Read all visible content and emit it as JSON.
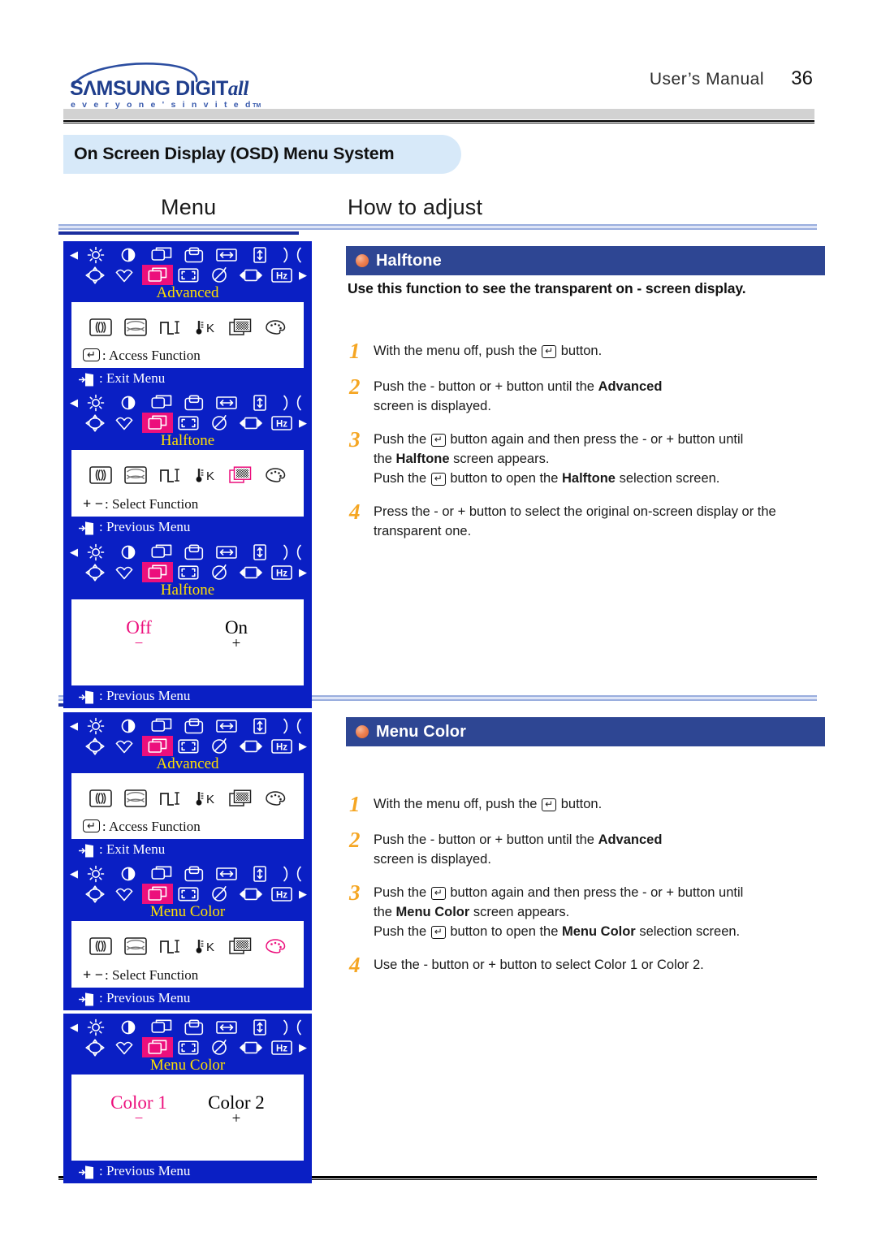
{
  "header": {
    "brand_primary": "SΛMSUNG DIGIT",
    "brand_italic": "all",
    "brand_tagline": "e v e r y o n e ' s   i n v i t e d",
    "brand_tm": "TM",
    "manual_label": "User’s Manual",
    "page_number": "36"
  },
  "title_band": {
    "text": "On Screen Display (OSD) Menu System"
  },
  "columns": {
    "menu": "Menu",
    "how_to_adjust": "How to adjust"
  },
  "icons": {
    "row1": [
      "brightness-icon",
      "contrast-icon",
      "h-position-icon",
      "v-position-icon",
      "h-size-icon",
      "v-size-icon",
      "pincushion-icon"
    ],
    "row2": [
      "rotation-icon",
      "trapezoid-icon",
      "advanced-icon",
      "zoom-icon",
      "degauss-icon",
      "moire-icon",
      "frequency-hz-icon"
    ],
    "submenu": [
      "purity-icon",
      "linearity-icon",
      "video-level-icon",
      "color-temp-k-icon",
      "halftone-icon",
      "menu-color-palette-icon"
    ],
    "hz_label": "Hz",
    "kelvin_label": "K",
    "left_arrow": "◀",
    "right_arrow": "▶"
  },
  "osd_panels": [
    {
      "id": "advanced-1",
      "title": "Advanced",
      "selected_top_index": 2,
      "selected_sub_index": -1,
      "hint": ": Access Function",
      "hint_glyph": "enter-key",
      "footer": ": Exit Menu",
      "footer_glyph": "exit-door"
    },
    {
      "id": "halftone-selected",
      "title": "Halftone",
      "selected_top_index": 2,
      "selected_sub_index": 4,
      "hint": ": Select Function",
      "hint_glyph": "plus-minus",
      "hint_prefix": "+ −",
      "footer": ": Previous Menu",
      "footer_glyph": "exit-door"
    },
    {
      "id": "halftone-options",
      "title": "Halftone",
      "selected_top_index": 2,
      "options": [
        {
          "label": "Off",
          "sign": "−",
          "state": "selected"
        },
        {
          "label": "On",
          "sign": "+",
          "state": "normal"
        }
      ],
      "footer": ": Previous Menu",
      "footer_glyph": "exit-door"
    },
    {
      "id": "advanced-2",
      "title": "Advanced",
      "selected_top_index": 2,
      "selected_sub_index": -1,
      "hint": ": Access Function",
      "hint_glyph": "enter-key",
      "footer": ": Exit Menu",
      "footer_glyph": "exit-door"
    },
    {
      "id": "menucolor-selected",
      "title": "Menu Color",
      "selected_top_index": 2,
      "selected_sub_index": 5,
      "hint": ": Select Function",
      "hint_glyph": "plus-minus",
      "hint_prefix": "+ −",
      "footer": ": Previous Menu",
      "footer_glyph": "exit-door"
    },
    {
      "id": "menucolor-options",
      "title": "Menu Color",
      "selected_top_index": 2,
      "options": [
        {
          "label": "Color 1",
          "sign": "−",
          "state": "selected"
        },
        {
          "label": "Color 2",
          "sign": "+",
          "state": "normal"
        }
      ],
      "footer": ": Previous Menu",
      "footer_glyph": "exit-door"
    }
  ],
  "sections": [
    {
      "id": "halftone",
      "title": "Halftone",
      "lead": "Use this function to see the transparent on - screen display.",
      "steps": [
        {
          "num": "1",
          "html": "With the menu off, push the <span class=\"inlinekey\">↵</span> button."
        },
        {
          "num": "2",
          "html": "Push the - button or  + button until the <b>Advanced</b><br>screen is displayed."
        },
        {
          "num": "3",
          "html": "Push the <span class=\"inlinekey\">↵</span> button again and then press the - or + button until<br>the <b>Halftone</b> screen appears.<br>Push the <span class=\"inlinekey\">↵</span> button to open the <b>Halftone</b> selection screen."
        },
        {
          "num": "4",
          "html": "Press the - or + button to select the original on-screen display or the<br>transparent one."
        }
      ]
    },
    {
      "id": "menu-color",
      "title": "Menu Color",
      "lead": "",
      "steps": [
        {
          "num": "1",
          "html": "With the menu off, push the <span class=\"inlinekey\">↵</span> button."
        },
        {
          "num": "2",
          "html": "Push the - button or  + button until the <b>Advanced</b><br>screen is displayed."
        },
        {
          "num": "3",
          "html": "Push the <span class=\"inlinekey\">↵</span> button again and then press the - or + button until<br>the <b>Menu Color</b> screen appears.<br>Push the <span class=\"inlinekey\">↵</span> button to open the <b>Menu Color</b> selection screen."
        },
        {
          "num": "4",
          "html": "Use the - button or + button to select Color 1 or Color 2."
        }
      ]
    }
  ],
  "colors": {
    "osd_blue": "#0a1fc4",
    "osd_highlight": "#ec0f7c",
    "osd_title_yellow": "#ffe000",
    "section_header_blue": "#2e4693",
    "step_number_orange": "#f5a623",
    "title_band_blue": "#d7e9f9",
    "brand_blue": "#1f3e8c"
  }
}
